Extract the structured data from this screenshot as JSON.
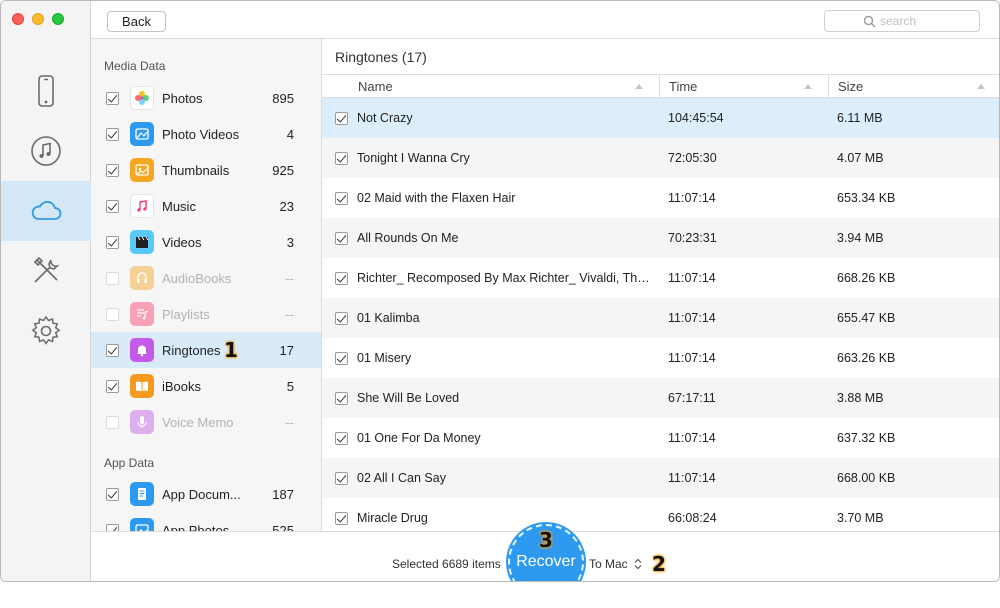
{
  "toolbar": {
    "back_label": "Back",
    "search_placeholder": "search"
  },
  "rail": {
    "items": [
      {
        "name": "device",
        "icon": "iphone-icon"
      },
      {
        "name": "itunes",
        "icon": "music-note-icon"
      },
      {
        "name": "icloud",
        "icon": "cloud-icon",
        "active": true
      },
      {
        "name": "tools",
        "icon": "tools-icon"
      },
      {
        "name": "settings",
        "icon": "gear-icon"
      }
    ]
  },
  "sidebar": {
    "media_section_label": "Media Data",
    "app_section_label": "App Data",
    "media_items": [
      {
        "label": "Photos",
        "count": "895",
        "checked": true
      },
      {
        "label": "Photo Videos",
        "count": "4",
        "checked": true
      },
      {
        "label": "Thumbnails",
        "count": "925",
        "checked": true
      },
      {
        "label": "Music",
        "count": "23",
        "checked": true
      },
      {
        "label": "Videos",
        "count": "3",
        "checked": true
      },
      {
        "label": "AudioBooks",
        "count": "--",
        "disabled": true
      },
      {
        "label": "Playlists",
        "count": "--",
        "disabled": true
      },
      {
        "label": "Ringtones",
        "count": "17",
        "checked": true,
        "selected": true
      },
      {
        "label": "iBooks",
        "count": "5",
        "checked": true
      },
      {
        "label": "Voice Memo",
        "count": "--",
        "disabled": true
      }
    ],
    "app_items": [
      {
        "label": "App Docum...",
        "count": "187",
        "checked": true
      },
      {
        "label": "App Photos",
        "count": "525",
        "checked": true
      }
    ]
  },
  "main": {
    "title": "Ringtones (17)",
    "columns": {
      "name": "Name",
      "time": "Time",
      "size": "Size"
    },
    "rows": [
      {
        "name": "Not Crazy",
        "time": "104:45:54",
        "size": "6.11 MB"
      },
      {
        "name": "Tonight I Wanna Cry",
        "time": "72:05:30",
        "size": "4.07 MB"
      },
      {
        "name": "02 Maid with the Flaxen Hair",
        "time": "11:07:14",
        "size": "653.34 KB"
      },
      {
        "name": "All Rounds On Me",
        "time": "70:23:31",
        "size": "3.94 MB"
      },
      {
        "name": "Richter_ Recomposed By Max Richter_ Vivaldi, The F...",
        "time": "11:07:14",
        "size": "668.26 KB"
      },
      {
        "name": "01 Kalimba",
        "time": "11:07:14",
        "size": "655.47 KB"
      },
      {
        "name": "01 Misery",
        "time": "11:07:14",
        "size": "663.26 KB"
      },
      {
        "name": "She Will Be Loved",
        "time": "67:17:11",
        "size": "3.88 MB"
      },
      {
        "name": "01 One For Da Money",
        "time": "11:07:14",
        "size": "637.32 KB"
      },
      {
        "name": "02 All I Can Say",
        "time": "11:07:14",
        "size": "668.00 KB"
      },
      {
        "name": "Miracle Drug",
        "time": "66:08:24",
        "size": "3.70 MB"
      }
    ]
  },
  "bottom": {
    "selected_text": "Selected 6689 items",
    "recover_label": "Recover",
    "target_label": "To Mac"
  },
  "annotations": {
    "step1": "1",
    "step2": "2",
    "step3": "3"
  }
}
